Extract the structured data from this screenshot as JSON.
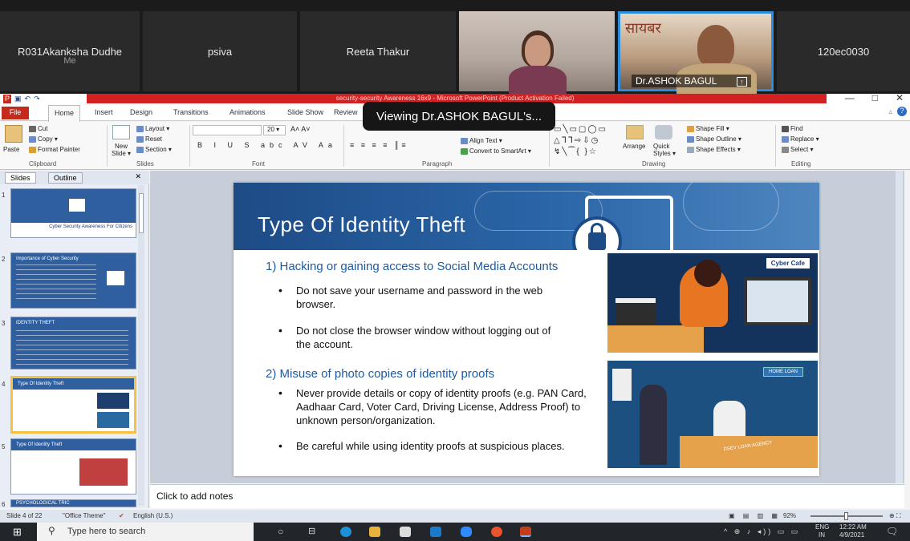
{
  "meeting": {
    "participants": [
      {
        "name": "R031Akanksha Dudhe",
        "sub": "Me"
      },
      {
        "name": "psiva"
      },
      {
        "name": "Reeta Thakur"
      },
      {
        "name": ""
      },
      {
        "name": "Dr.ASHOK BAGUL"
      },
      {
        "name": "120ec0030"
      }
    ],
    "viewing_toast": "Viewing Dr.ASHOK BAGUL's..."
  },
  "window": {
    "title": "security-security Awareness 16x9 - Microsoft PowerPoint (Product Activation Failed)",
    "controls": [
      "—",
      "□",
      "✕"
    ]
  },
  "ribbon": {
    "tabs": [
      "File",
      "Home",
      "Insert",
      "Design",
      "Transitions",
      "Animations",
      "Slide Show",
      "Review"
    ],
    "clipboard": {
      "paste": "Paste",
      "cut": "Cut",
      "copy": "Copy ▾",
      "format_painter": "Format Painter",
      "label": "Clipboard"
    },
    "slides": {
      "new_slide": "New Slide ▾",
      "layout": "Layout ▾",
      "reset": "Reset",
      "section": "Section ▾",
      "label": "Slides"
    },
    "font": {
      "size": "20",
      "label": "Font"
    },
    "paragraph": {
      "align_text": "Align Text ▾",
      "smartart": "Convert to SmartArt ▾",
      "label": "Paragraph"
    },
    "drawing": {
      "arrange": "Arrange",
      "quick_styles": "Quick Styles ▾",
      "fill": "Shape Fill ▾",
      "outline": "Shape Outline ▾",
      "effects": "Shape Effects ▾",
      "label": "Drawing"
    },
    "editing": {
      "find": "Find",
      "replace": "Replace ▾",
      "select": "Select ▾",
      "label": "Editing"
    }
  },
  "pane": {
    "tabs": [
      "Slides",
      "Outline"
    ],
    "close": "✕",
    "thumbs": [
      {
        "num": "1",
        "title": "",
        "caption": "Cyber Security Awareness For Citizens"
      },
      {
        "num": "2",
        "title": "Importance of Cyber Security",
        "caption": ""
      },
      {
        "num": "3",
        "title": "IDENTITY THEFT",
        "caption": ""
      },
      {
        "num": "4",
        "title": "Type Of Identity Theft",
        "caption": ""
      },
      {
        "num": "5",
        "title": "Type Of Identity Theft",
        "caption": ""
      },
      {
        "num": "6",
        "title": "PSYCHOLOGICAL TRIC",
        "caption": ""
      }
    ]
  },
  "slide": {
    "title": "Type Of Identity Theft",
    "section1": "1) Hacking or gaining access to Social Media Accounts",
    "b1": "Do not save your username and password in the web browser.",
    "b2": "Do not close the browser window without logging out of the account.",
    "section2": "2) Misuse of photo copies of identity proofs",
    "b3": "Never provide details or copy of identity proofs (e.g. PAN Card, Aadhaar Card, Voter Card, Driving License, Address Proof) to unknown person/organization.",
    "b4": "Be careful while using identity proofs at suspicious places.",
    "img1_label": "Cyber Cafe",
    "img2_label": "HOME LOAN",
    "img2_sign": "DSEV LOAN AGENCY"
  },
  "notes_placeholder": "Click to add notes",
  "status": {
    "slide_of": "Slide 4 of 22",
    "theme": "\"Office Theme\"",
    "language": "English (U.S.)",
    "zoom": "92%"
  },
  "taskbar": {
    "search_placeholder": "Type here to search",
    "lang": "ENG",
    "region": "IN",
    "time": "12:22 AM",
    "date": "4/9/2021"
  },
  "colors": {
    "ppt_red": "#d32020",
    "slide_blue": "#1d4b86",
    "heading_blue": "#1f5aa0",
    "taskbar": "#22262b",
    "active_speaker": "#2b8de0"
  }
}
